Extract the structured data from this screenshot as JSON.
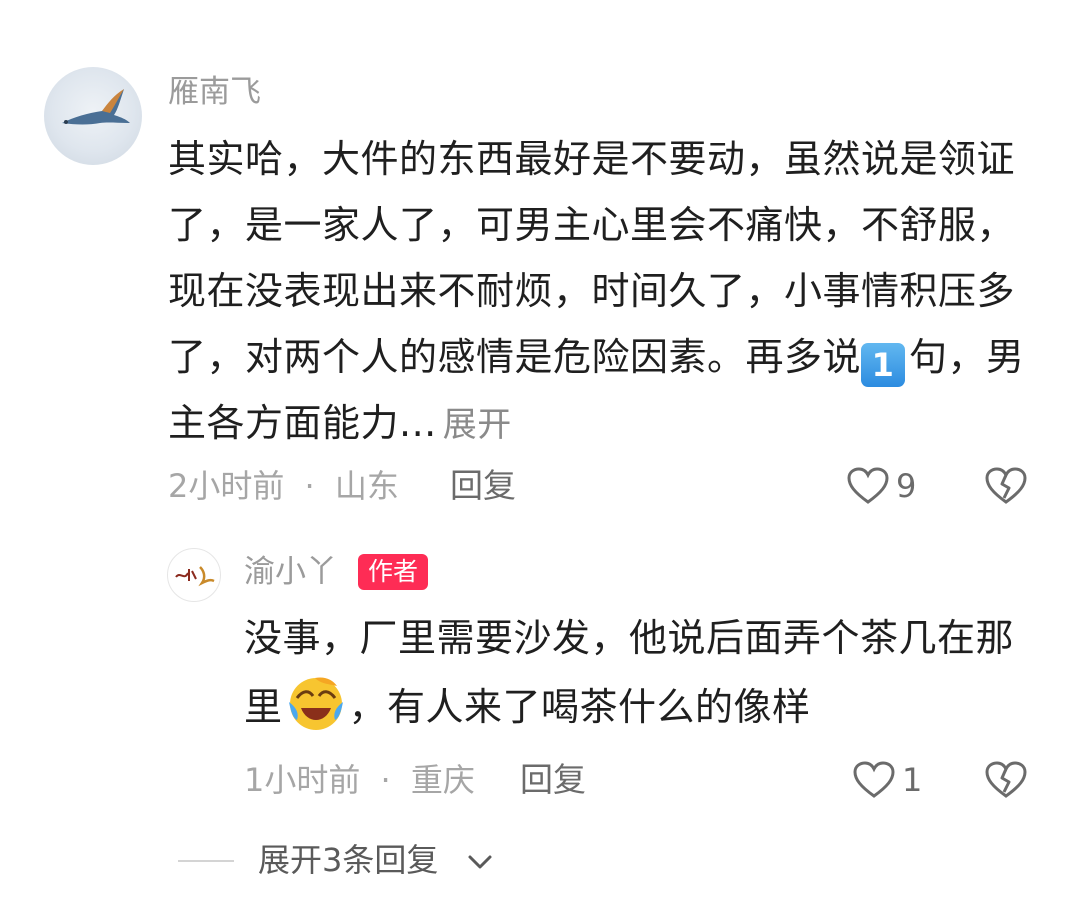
{
  "comment": {
    "username": "雁南飞",
    "text_main": "其实哈，大件的东西最好是不要动，虽然说是领证了，是一家人了，可男主心里会不痛快，不舒服，现在没表现出来不耐烦，时间久了，小事情积压多了，对两个人的感情是危险因素。再多说",
    "number_badge": "1",
    "text_tail": "句，男主各方面能力...",
    "expand_label": "展开",
    "time": "2小时前",
    "separator": "·",
    "location": "山东",
    "reply_label": "回复",
    "like_count": "9",
    "icons": {
      "avatar": "bird-avatar-icon",
      "like": "heart-outline-icon",
      "dislike": "broken-heart-icon"
    }
  },
  "reply": {
    "username": "渝小丫",
    "author_badge": "作者",
    "text_part1": "没事，厂里需要沙发，他说后面弄个茶几在那里",
    "emoji_name": "laughing-crying-emoji",
    "text_part2": "，有人来了喝茶什么的像样",
    "time": "1小时前",
    "separator": "·",
    "location": "重庆",
    "reply_label": "回复",
    "like_count": "1",
    "avatar_text": "渝小丫",
    "icons": {
      "avatar": "calligraphy-avatar-icon",
      "like": "heart-outline-icon",
      "dislike": "broken-heart-icon"
    }
  },
  "expand_replies": {
    "label": "展开3条回复",
    "icon": "chevron-down-icon"
  },
  "colors": {
    "author_badge_bg": "#fe2c55",
    "meta_text": "#a6a6a6",
    "body_text": "#1f1f1f"
  }
}
